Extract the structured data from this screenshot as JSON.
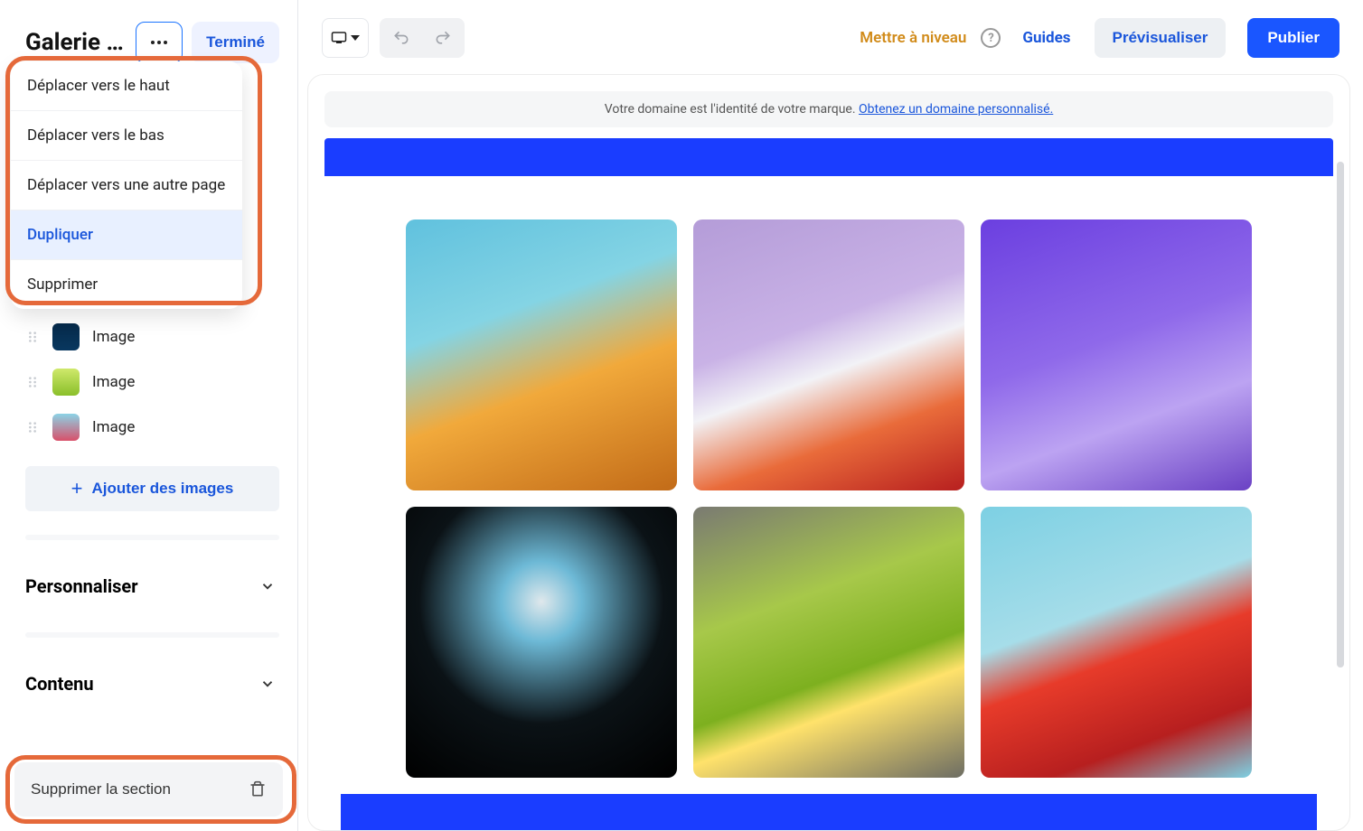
{
  "sidebar": {
    "title": "Galerie d'i…",
    "done_label": "Terminé",
    "menu": {
      "move_up": "Déplacer vers le haut",
      "move_down": "Déplacer vers le bas",
      "move_other_page": "Déplacer vers une autre page",
      "duplicate": "Dupliquer",
      "delete": "Supprimer"
    },
    "images": {
      "row1": "Image",
      "row2": "Image",
      "row3": "Image"
    },
    "add_images": "Ajouter des images",
    "personalize": "Personnaliser",
    "content": "Contenu",
    "delete_section": "Supprimer la section"
  },
  "topbar": {
    "upgrade": "Mettre à niveau",
    "guides": "Guides",
    "preview": "Prévisualiser",
    "publish": "Publier"
  },
  "banner": {
    "text": "Votre domaine est l'identité de votre marque. ",
    "link": "Obtenez un domaine personnalisé."
  }
}
